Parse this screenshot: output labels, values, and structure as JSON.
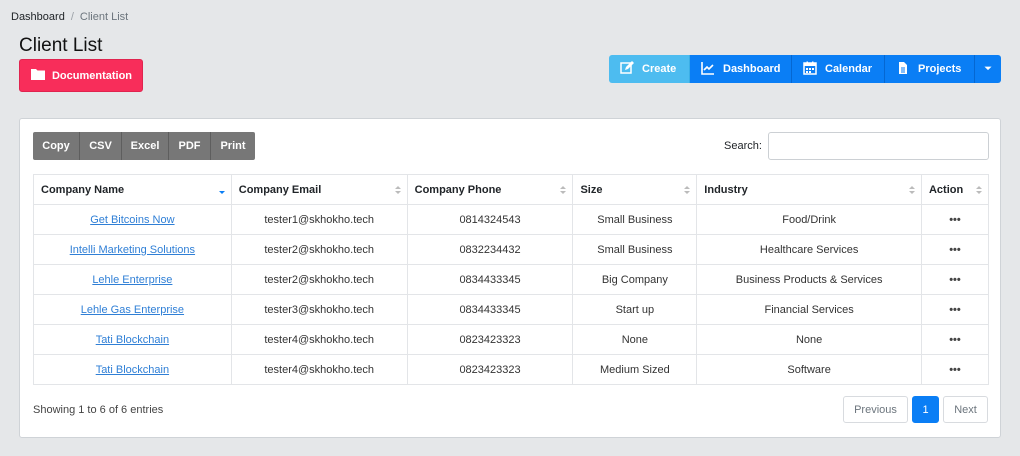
{
  "breadcrumb": {
    "home": "Dashboard",
    "separator": "/",
    "current": "Client List"
  },
  "page_title": "Client List",
  "documentation_label": "Documentation",
  "toolbar": {
    "create": "Create",
    "dashboard": "Dashboard",
    "calendar": "Calendar",
    "projects": "Projects"
  },
  "export": [
    "Copy",
    "CSV",
    "Excel",
    "PDF",
    "Print"
  ],
  "search": {
    "label": "Search:",
    "value": ""
  },
  "table": {
    "headers": [
      "Company Name",
      "Company Email",
      "Company Phone",
      "Size",
      "Industry",
      "Action"
    ],
    "rows": [
      {
        "name": "Get Bitcoins Now",
        "email": "tester1@skhokho.tech",
        "phone": "0814324543",
        "size": "Small Business",
        "industry": "Food/Drink"
      },
      {
        "name": "Intelli Marketing Solutions",
        "email": "tester2@skhokho.tech",
        "phone": "0832234432",
        "size": "Small Business",
        "industry": "Healthcare Services"
      },
      {
        "name": "Lehle Enterprise",
        "email": "tester2@skhokho.tech",
        "phone": "0834433345",
        "size": "Big Company",
        "industry": "Business Products & Services"
      },
      {
        "name": "Lehle Gas Enterprise",
        "email": "tester3@skhokho.tech",
        "phone": "0834433345",
        "size": "Start up",
        "industry": "Financial Services"
      },
      {
        "name": "Tati Blockchain",
        "email": "tester4@skhokho.tech",
        "phone": "0823423323",
        "size": "None",
        "industry": "None"
      },
      {
        "name": "Tati Blockchain",
        "email": "tester4@skhokho.tech",
        "phone": "0823423323",
        "size": "Medium Sized",
        "industry": "Software"
      }
    ],
    "action_glyph": "•••"
  },
  "footer": {
    "info": "Showing 1 to 6 of 6 entries",
    "previous": "Previous",
    "page": "1",
    "next": "Next"
  },
  "colors": {
    "accent": "#0a7ef5",
    "create": "#4dbcf0",
    "documentation": "#f82d5a",
    "export": "#777777"
  }
}
